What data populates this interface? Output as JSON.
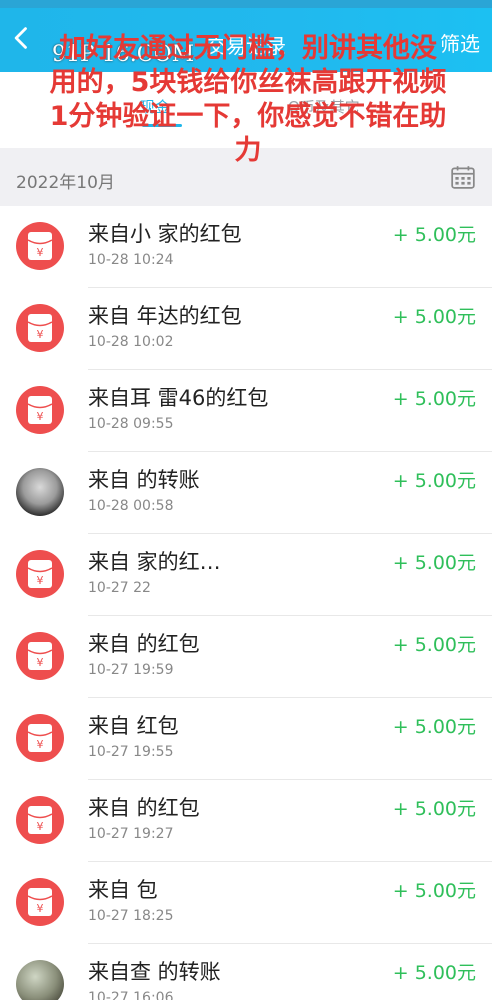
{
  "header": {
    "title": "交易记录",
    "filter_label": "筛选"
  },
  "tabs": [
    {
      "label": "现金",
      "active": true
    },
    {
      "label": "Q币及其它",
      "active": false
    }
  ],
  "month": "2022年10月",
  "transactions": [
    {
      "title": "来自小 家的红包",
      "time": "10-28 10:24",
      "amount": "+ 5.00元",
      "icon": "red-packet-icon"
    },
    {
      "title": "来自 年达的红包",
      "time": "10-28 10:02",
      "amount": "+ 5.00元",
      "icon": "red-packet-icon"
    },
    {
      "title": "来自耳 雷46的红包",
      "time": "10-28 09:55",
      "amount": "+ 5.00元",
      "icon": "red-packet-icon"
    },
    {
      "title": "来自 的转账",
      "time": "10-28 00:58",
      "amount": "+ 5.00元",
      "icon": "avatar-photo"
    },
    {
      "title": "来自 家的红…",
      "time": "10-27 22",
      "amount": "+ 5.00元",
      "icon": "red-packet-icon"
    },
    {
      "title": "来自 的红包",
      "time": "10-27 19:59",
      "amount": "+ 5.00元",
      "icon": "red-packet-icon"
    },
    {
      "title": "来自 红包",
      "time": "10-27 19:55",
      "amount": "+ 5.00元",
      "icon": "red-packet-icon"
    },
    {
      "title": "来自 的红包",
      "time": "10-27 19:27",
      "amount": "+ 5.00元",
      "icon": "red-packet-icon"
    },
    {
      "title": "来自 包",
      "time": "10-27 18:25",
      "amount": "+ 5.00元",
      "icon": "red-packet-icon"
    },
    {
      "title": "来自查 的转账",
      "time": "10-27 16:06",
      "amount": "+ 5.00元",
      "icon": "avatar-photo"
    }
  ],
  "overlay_text": "加好友通过无门槛，别讲其他没用的，5块钱给你丝袜高跟开视频1分钟验证一下，你感觉不错在助力",
  "watermark_site": "91P 16.COM",
  "colors": {
    "header": "#1fb6ea",
    "red_packet": "#ee4e4e",
    "amount": "#2fbf5a",
    "overlay_text": "#e53935"
  }
}
